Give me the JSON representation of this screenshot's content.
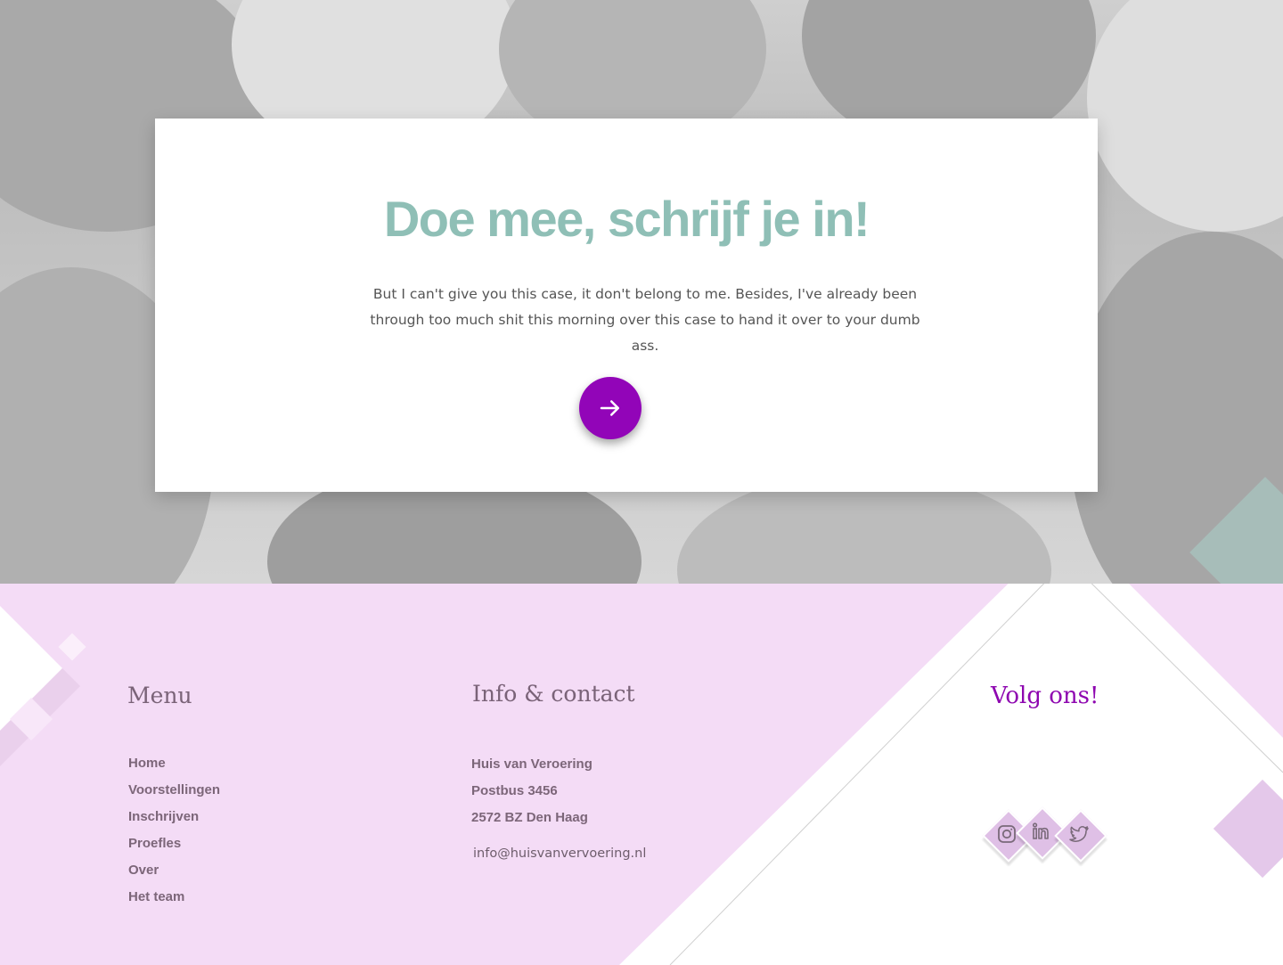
{
  "hero": {
    "title": "Doe mee, schrijf je in!",
    "text": "But I can't give you this case, it don't belong to me. Besides, I've already been through too much shit this morning over this case to hand it over to your dumb ass.",
    "cta_icon": "arrow-right-icon"
  },
  "footer": {
    "menu_title": "Menu",
    "menu_items": [
      "Home",
      "Voorstellingen",
      "Inschrijven",
      "Proefles",
      "Over",
      "Het team"
    ],
    "contact_title": "Info & contact",
    "contact_lines": [
      "Huis van Veroering",
      "Postbus 3456",
      "2572 BZ Den Haag"
    ],
    "email": "info@huisvanvervoering.nl",
    "follow_title": "Volg ons!",
    "social": [
      "instagram-icon",
      "linkedin-icon",
      "twitter-icon"
    ]
  },
  "colors": {
    "title": "#8fbfb6",
    "accent": "#9205b8",
    "footer_bg": "#f4dcf6",
    "footer_text": "#7c6679"
  }
}
